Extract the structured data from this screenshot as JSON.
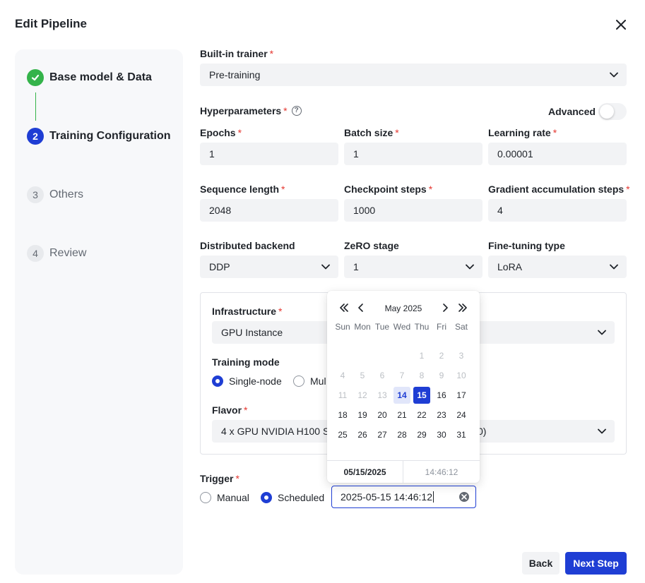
{
  "modal": {
    "title": "Edit Pipeline"
  },
  "steps": [
    {
      "label": "Base model & Data",
      "state": "done"
    },
    {
      "number": "2",
      "label": "Training Configuration",
      "state": "active"
    },
    {
      "number": "3",
      "label": "Others",
      "state": "pending"
    },
    {
      "number": "4",
      "label": "Review",
      "state": "pending"
    }
  ],
  "trainer": {
    "label": "Built-in trainer",
    "value": "Pre-training"
  },
  "hyperparameters": {
    "label": "Hyperparameters",
    "advanced_label": "Advanced",
    "advanced_on": false
  },
  "fields": {
    "epochs": {
      "label": "Epochs",
      "value": "1"
    },
    "batch_size": {
      "label": "Batch size",
      "value": "1"
    },
    "learning_rate": {
      "label": "Learning rate",
      "value": "0.00001"
    },
    "sequence_length": {
      "label": "Sequence length",
      "value": "2048"
    },
    "checkpoint_steps": {
      "label": "Checkpoint steps",
      "value": "1000"
    },
    "grad_accum": {
      "label": "Gradient accumulation steps",
      "value": "4"
    },
    "distributed_backend": {
      "label": "Distributed backend",
      "value": "DDP"
    },
    "zero_stage": {
      "label": "ZeRO stage",
      "value": "1"
    },
    "finetuning_type": {
      "label": "Fine-tuning type",
      "value": "LoRA"
    }
  },
  "infrastructure": {
    "label": "Infrastructure",
    "value": "GPU Instance",
    "training_mode_label": "Training mode",
    "mode_single": "Single-node",
    "mode_multi": "Mul",
    "flavor_label": "Flavor",
    "flavor_value_left": "4 x GPU NVIDIA H100 SX",
    "flavor_value_right": "0)"
  },
  "trigger": {
    "label": "Trigger",
    "manual": "Manual",
    "scheduled": "Scheduled",
    "selected": "scheduled",
    "datetime_value": "2025-05-15 14:46:12"
  },
  "calendar": {
    "month": "May 2025",
    "weekdays": [
      "Sun",
      "Mon",
      "Tue",
      "Wed",
      "Thu",
      "Fri",
      "Sat"
    ],
    "weeks": [
      [
        "",
        "",
        "",
        "",
        "1",
        "2",
        "3"
      ],
      [
        "4",
        "5",
        "6",
        "7",
        "8",
        "9",
        "10"
      ],
      [
        "11",
        "12",
        "13",
        "14",
        "15",
        "16",
        "17"
      ],
      [
        "18",
        "19",
        "20",
        "21",
        "22",
        "23",
        "24"
      ],
      [
        "25",
        "26",
        "27",
        "28",
        "29",
        "30",
        "31"
      ]
    ],
    "disabled_through": 13,
    "today": "14",
    "selected": "15",
    "footer_date": "05/15/2025",
    "footer_time": "14:46:12",
    "prev_year_icon": "double-chevron-left-icon",
    "prev_month_icon": "chevron-left-icon",
    "next_month_icon": "chevron-right-icon",
    "next_year_icon": "double-chevron-right-icon"
  },
  "buttons": {
    "back": "Back",
    "next": "Next Step"
  },
  "colors": {
    "primary": "#1f3ed4",
    "success": "#34b34a",
    "required": "#e5362f"
  }
}
